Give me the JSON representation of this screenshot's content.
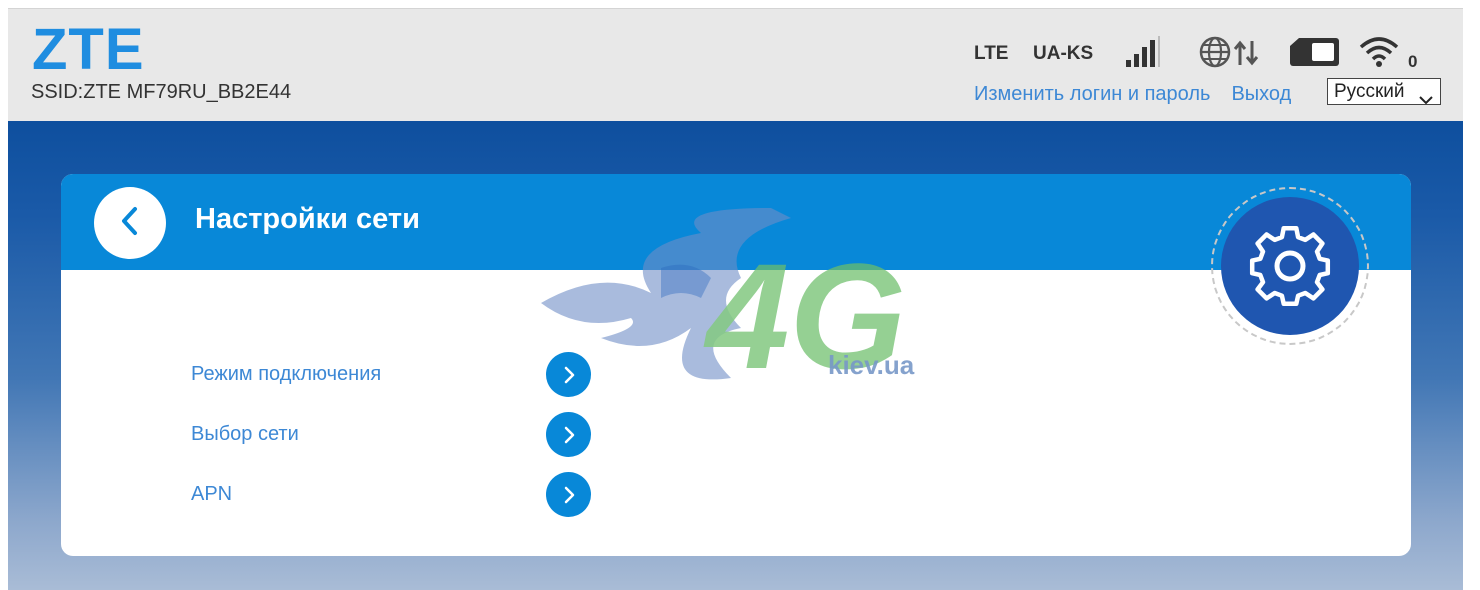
{
  "header": {
    "logo": "ZTE",
    "ssid": "SSID:ZTE MF79RU_BB2E44"
  },
  "status": {
    "network_type": "LTE",
    "operator": "UA-KS",
    "signal_icon": "signal-bars-icon",
    "internet_icon": "globe-icon",
    "transfer_icon": "up-down-arrows-icon",
    "battery_icon": "battery-icon",
    "wifi_icon": "wifi-icon",
    "wifi_clients": "0"
  },
  "links": {
    "change_login": "Изменить логин и пароль",
    "logout": "Выход"
  },
  "language": {
    "selected": "Русский"
  },
  "page": {
    "title": "Настройки сети",
    "back_icon": "chevron-left-icon",
    "section_icon": "gear-icon"
  },
  "menu": {
    "items": [
      {
        "label": "Режим подключения",
        "icon": "chevron-right-icon"
      },
      {
        "label": "Выбор сети",
        "icon": "chevron-right-icon"
      },
      {
        "label": "APN",
        "icon": "chevron-right-icon"
      }
    ]
  },
  "watermark": {
    "logo_text": "4G",
    "domain": "kiev.ua"
  },
  "colors": {
    "accent": "#0888d8",
    "link": "#3d88d5",
    "logo": "#1f8de0",
    "gear_bg": "#1f56b0",
    "topbar_bg": "#e8e8e8"
  }
}
